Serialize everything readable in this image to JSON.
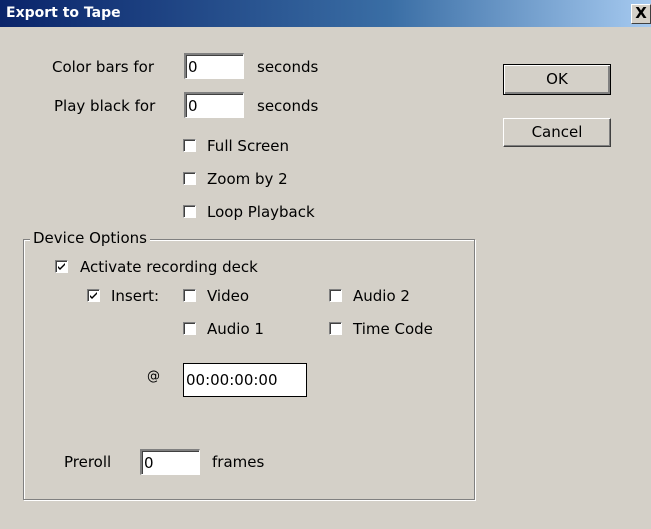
{
  "window": {
    "title": "Export to Tape",
    "close_glyph": "X"
  },
  "color_bars": {
    "label": "Color bars for",
    "value": "0",
    "unit": "seconds"
  },
  "play_black": {
    "label": "Play black for",
    "value": "0",
    "unit": "seconds"
  },
  "options": {
    "full_screen": {
      "label": "Full Screen",
      "checked": false
    },
    "zoom_by_2": {
      "label": "Zoom by 2",
      "checked": false
    },
    "loop_playback": {
      "label": "Loop Playback",
      "checked": false
    }
  },
  "buttons": {
    "ok": "OK",
    "cancel": "Cancel"
  },
  "device_options": {
    "legend": "Device Options",
    "activate_deck": {
      "label": "Activate recording deck",
      "checked": true
    },
    "insert": {
      "label": "Insert:",
      "checked": true
    },
    "video": {
      "label": "Video",
      "checked": false
    },
    "audio1": {
      "label": "Audio 1",
      "checked": false
    },
    "audio2": {
      "label": "Audio 2",
      "checked": false
    },
    "time_code": {
      "label": "Time Code",
      "checked": false
    },
    "at_symbol": "@",
    "timecode_value": "00:00:00:00",
    "preroll": {
      "label": "Preroll",
      "value": "0",
      "unit": "frames"
    }
  }
}
